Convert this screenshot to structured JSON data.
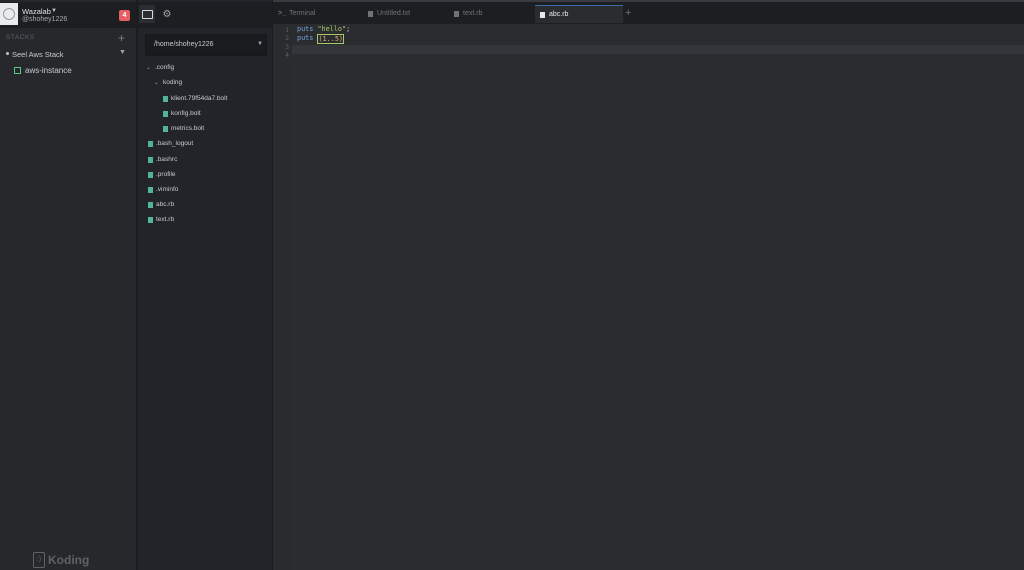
{
  "sidebar": {
    "team_name": "Wazalab",
    "username": "@shohey1226",
    "notification_count": "4",
    "stacks_label": "STACKS",
    "stack_name": "Seel Aws Stack",
    "machine_name": "aws-instance",
    "logo_text": "Koding"
  },
  "files": {
    "path": "/home/shohey1226",
    "items": [
      {
        "label": ".config",
        "type": "folder"
      },
      {
        "label": "koding",
        "type": "folder"
      },
      {
        "label": "klient.79f54da7.bolt",
        "type": "file"
      },
      {
        "label": "konfig.bolt",
        "type": "file"
      },
      {
        "label": "metrics.bolt",
        "type": "file"
      },
      {
        "label": ".bash_logout",
        "type": "file"
      },
      {
        "label": ".bashrc",
        "type": "file"
      },
      {
        "label": ".profile",
        "type": "file"
      },
      {
        "label": ".viminfo",
        "type": "file"
      },
      {
        "label": "abc.rb",
        "type": "file"
      },
      {
        "label": "text.rb",
        "type": "file"
      }
    ]
  },
  "tabs": [
    {
      "label": "Terminal",
      "icon": "terminal-icon"
    },
    {
      "label": "Untitled.txt",
      "icon": "document-icon"
    },
    {
      "label": "text.rb",
      "icon": "document-icon"
    },
    {
      "label": "abc.rb",
      "icon": "document-icon",
      "active": true
    }
  ],
  "editor": {
    "line_numbers": [
      "1",
      "2",
      "3",
      "4"
    ],
    "lines": [
      {
        "kw": "puts",
        "arg": "\"hello\"",
        "end": ";"
      },
      {
        "kw": "puts",
        "arg": "(1..5)",
        "end": ""
      }
    ]
  },
  "colors": {
    "accent": "#3b6aa6",
    "file_icon": "#52b49b",
    "machine_status": "#52c882",
    "badge": "#e55f63"
  }
}
